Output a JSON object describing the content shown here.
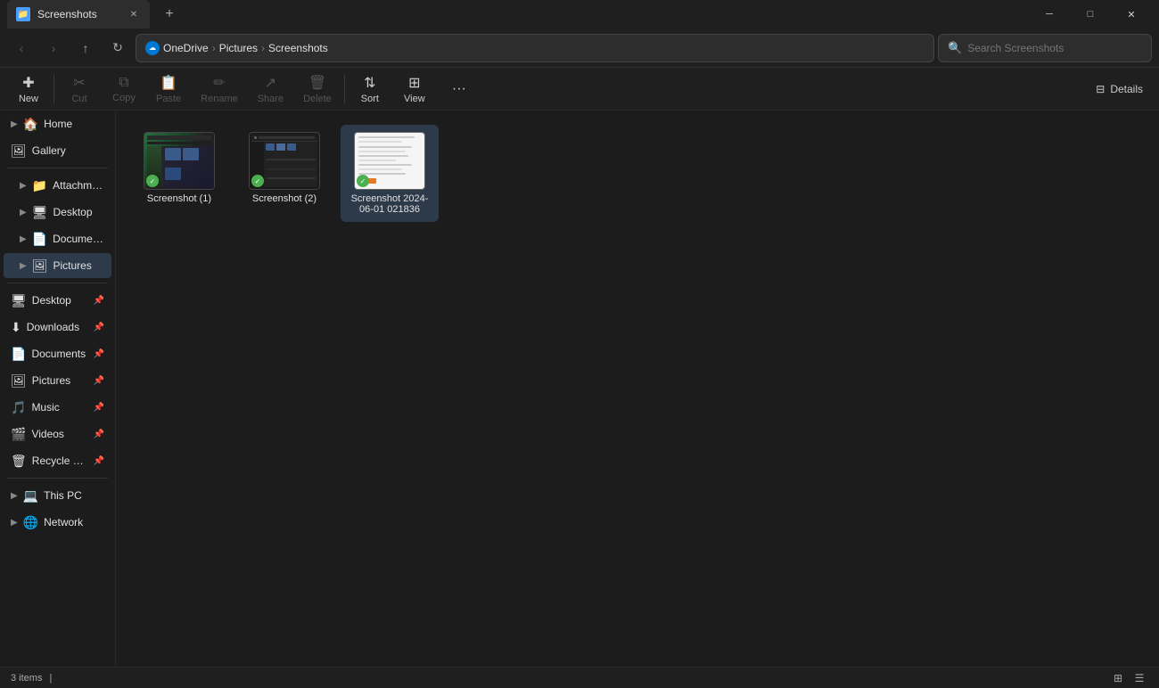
{
  "titleBar": {
    "tab": {
      "title": "Screenshots",
      "icon": "📁"
    },
    "newTabLabel": "+",
    "windowControls": {
      "minimize": "─",
      "maximize": "□",
      "close": "✕"
    }
  },
  "addressBar": {
    "backBtn": "‹",
    "forwardBtn": "›",
    "upBtn": "↑",
    "refreshBtn": "↻",
    "breadcrumb": [
      {
        "icon": "☁",
        "label": "OneDrive"
      },
      {
        "label": "Pictures"
      },
      {
        "label": "Screenshots"
      }
    ],
    "searchPlaceholder": "Search Screenshots"
  },
  "toolbar": {
    "newLabel": "New",
    "cutLabel": "Cut",
    "copyLabel": "Copy",
    "pasteLabel": "Paste",
    "renameLabel": "Rename",
    "shareLabel": "Share",
    "deleteLabel": "Delete",
    "sortLabel": "Sort",
    "viewLabel": "View",
    "moreLabel": "...",
    "detailsLabel": "Details"
  },
  "sidebar": {
    "items": [
      {
        "id": "home",
        "icon": "🏠",
        "label": "Home",
        "expandable": true
      },
      {
        "id": "gallery",
        "icon": "🖼",
        "label": "Gallery",
        "expandable": false
      },
      {
        "id": "attachments",
        "icon": "📁",
        "label": "Attachments",
        "expandable": true,
        "indented": true
      },
      {
        "id": "desktop",
        "icon": "🖥",
        "label": "Desktop",
        "expandable": true,
        "indented": true
      },
      {
        "id": "documents",
        "icon": "📄",
        "label": "Documents",
        "expandable": true,
        "indented": true
      },
      {
        "id": "pictures",
        "icon": "🖼",
        "label": "Pictures",
        "expandable": true,
        "indented": true,
        "active": true
      },
      {
        "id": "desktop2",
        "icon": "🖥",
        "label": "Desktop",
        "pinned": true
      },
      {
        "id": "downloads",
        "icon": "⬇",
        "label": "Downloads",
        "pinned": true
      },
      {
        "id": "documents2",
        "icon": "📄",
        "label": "Documents",
        "pinned": true
      },
      {
        "id": "pictures2",
        "icon": "🖼",
        "label": "Pictures",
        "pinned": true
      },
      {
        "id": "music",
        "icon": "🎵",
        "label": "Music",
        "pinned": true
      },
      {
        "id": "videos",
        "icon": "🎬",
        "label": "Videos",
        "pinned": true
      },
      {
        "id": "recyclebin",
        "icon": "🗑",
        "label": "Recycle Bin",
        "pinned": true
      },
      {
        "id": "thispc",
        "icon": "💻",
        "label": "This PC",
        "expandable": true
      },
      {
        "id": "network",
        "icon": "🌐",
        "label": "Network",
        "expandable": true
      }
    ]
  },
  "fileArea": {
    "files": [
      {
        "id": "screenshot1",
        "name": "Screenshot (1)",
        "type": "image",
        "thumbnail": "thumb1",
        "checked": true
      },
      {
        "id": "screenshot2",
        "name": "Screenshot (2)",
        "type": "image",
        "thumbnail": "thumb2",
        "checked": true
      },
      {
        "id": "screenshot3",
        "name": "Screenshot 2024-06-01 021836",
        "type": "image",
        "thumbnail": "thumb3",
        "checked": true,
        "selected": true
      }
    ]
  },
  "statusBar": {
    "itemCount": "3 items",
    "dot": "|",
    "viewGrid": "⊞",
    "viewList": "☰"
  }
}
